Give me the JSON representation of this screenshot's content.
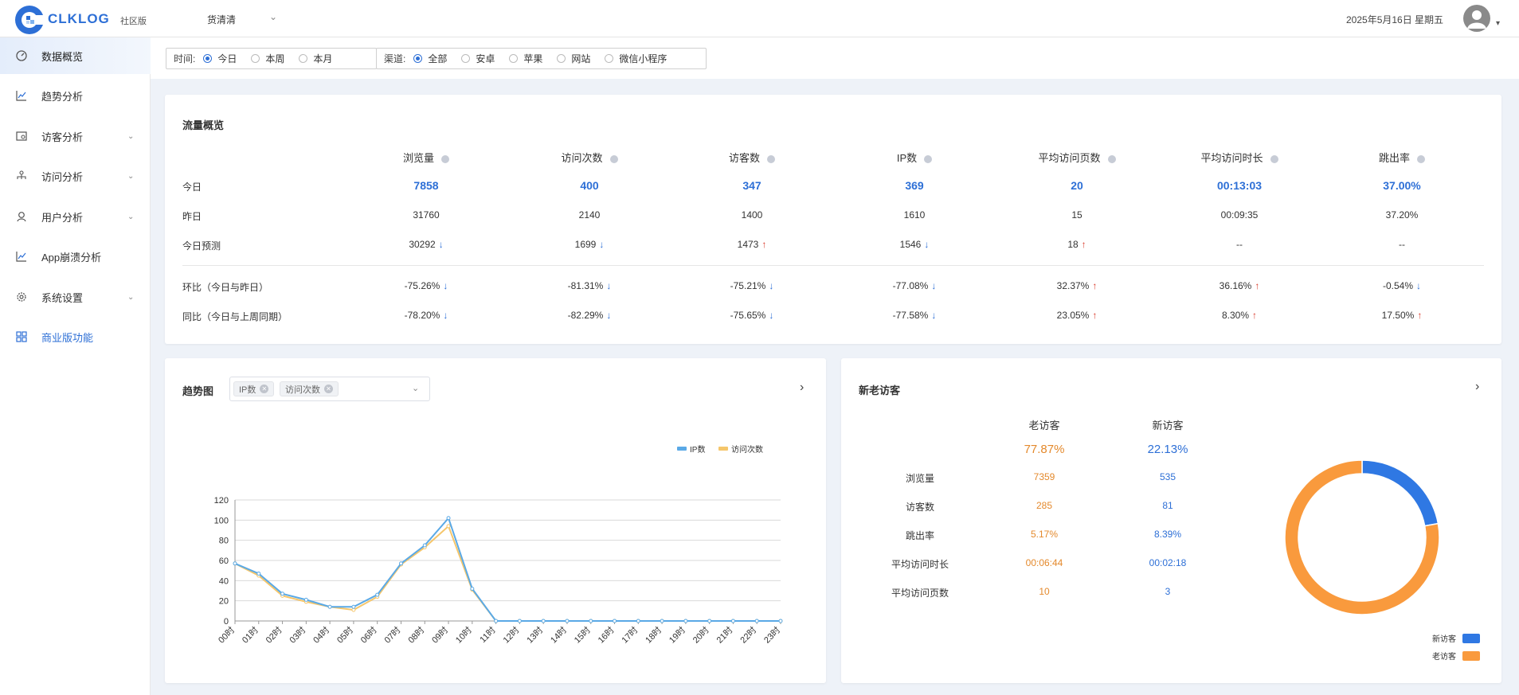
{
  "header": {
    "logo_text": "CLKLOG",
    "edition": "社区版",
    "project": "货清清",
    "date": "2025年5月16日 星期五"
  },
  "sidebar": {
    "items": [
      {
        "label": "数据概览",
        "icon": "dashboard-icon"
      },
      {
        "label": "趋势分析",
        "icon": "line-chart-icon"
      },
      {
        "label": "访客分析",
        "icon": "visitor-icon"
      },
      {
        "label": "访问分析",
        "icon": "sitemap-icon"
      },
      {
        "label": "用户分析",
        "icon": "user-icon"
      },
      {
        "label": "App崩溃分析",
        "icon": "line-chart-icon"
      },
      {
        "label": "系统设置",
        "icon": "gear-icon"
      },
      {
        "label": "商业版功能",
        "icon": "grid-icon"
      }
    ]
  },
  "filters": {
    "time_label": "时间:",
    "time_options": [
      "今日",
      "本周",
      "本月"
    ],
    "time_selected": "今日",
    "channel_label": "渠道:",
    "channel_options": [
      "全部",
      "安卓",
      "苹果",
      "网站",
      "微信小程序"
    ],
    "channel_selected": "全部"
  },
  "traffic": {
    "title": "流量概览",
    "columns": [
      "浏览量",
      "访问次数",
      "访客数",
      "IP数",
      "平均访问页数",
      "平均访问时长",
      "跳出率"
    ],
    "rows": {
      "today": {
        "label": "今日",
        "values": [
          "7858",
          "400",
          "347",
          "369",
          "20",
          "00:13:03",
          "37.00%"
        ]
      },
      "yesterday": {
        "label": "昨日",
        "values": [
          "31760",
          "2140",
          "1400",
          "1610",
          "15",
          "00:09:35",
          "37.20%"
        ]
      },
      "forecast": {
        "label": "今日预测",
        "values": [
          "30292",
          "1699",
          "1473",
          "1546",
          "18",
          "--",
          "--"
        ],
        "dirs": [
          "down",
          "down",
          "up",
          "down",
          "up",
          "",
          ""
        ]
      },
      "dod": {
        "label": "环比（今日与昨日）",
        "values": [
          "-75.26%",
          "-81.31%",
          "-75.21%",
          "-77.08%",
          "32.37%",
          "36.16%",
          "-0.54%"
        ],
        "dirs": [
          "down",
          "down",
          "down",
          "down",
          "up",
          "up",
          "down"
        ]
      },
      "wow": {
        "label": "同比（今日与上周同期）",
        "values": [
          "-78.20%",
          "-82.29%",
          "-75.65%",
          "-77.58%",
          "23.05%",
          "8.30%",
          "17.50%"
        ],
        "dirs": [
          "down",
          "down",
          "down",
          "down",
          "up",
          "up",
          "up"
        ]
      }
    }
  },
  "trend": {
    "title": "趋势图",
    "tags": [
      "IP数",
      "访问次数"
    ]
  },
  "chart_data": {
    "type": "line",
    "title": "",
    "categories": [
      "00时",
      "01时",
      "02时",
      "03时",
      "04时",
      "05时",
      "06时",
      "07时",
      "08时",
      "09时",
      "10时",
      "11时",
      "12时",
      "13时",
      "14时",
      "15时",
      "16时",
      "17时",
      "18时",
      "19时",
      "20时",
      "21时",
      "22时",
      "23时"
    ],
    "series": [
      {
        "name": "IP数",
        "color": "#5aa9e6",
        "values": [
          57,
          47,
          27,
          21,
          14,
          14,
          26,
          57,
          75,
          102,
          32,
          0,
          0,
          0,
          0,
          0,
          0,
          0,
          0,
          0,
          0,
          0,
          0,
          0
        ]
      },
      {
        "name": "访问次数",
        "color": "#f5c66b",
        "values": [
          57,
          45,
          25,
          19,
          14,
          11,
          24,
          56,
          73,
          94,
          31,
          0,
          0,
          0,
          0,
          0,
          0,
          0,
          0,
          0,
          0,
          0,
          0,
          0
        ]
      }
    ],
    "ylim": [
      0,
      120
    ],
    "yticks": [
      "0",
      "20",
      "40",
      "60",
      "80",
      "100",
      "120"
    ],
    "grid": true,
    "legend": "top-right"
  },
  "visitors": {
    "title": "新老访客",
    "old_label": "老访客",
    "new_label": "新访客",
    "old_pct": "77.87%",
    "new_pct": "22.13%",
    "rows": [
      {
        "label": "浏览量",
        "old": "7359",
        "new": "535"
      },
      {
        "label": "访客数",
        "old": "285",
        "new": "81"
      },
      {
        "label": "跳出率",
        "old": "5.17%",
        "new": "8.39%"
      },
      {
        "label": "平均访问时长",
        "old": "00:06:44",
        "new": "00:02:18"
      },
      {
        "label": "平均访问页数",
        "old": "10",
        "new": "3"
      }
    ],
    "donut": {
      "type": "pie",
      "slices": [
        {
          "name": "新访客",
          "value": 22.13,
          "color": "#2f78e3"
        },
        {
          "name": "老访客",
          "value": 77.87,
          "color": "#f99a3d"
        }
      ],
      "legend": [
        "新访客",
        "老访客"
      ]
    }
  },
  "colors": {
    "accent": "#2d6fd6",
    "up": "#d93a2b",
    "old": "#e4892c"
  }
}
